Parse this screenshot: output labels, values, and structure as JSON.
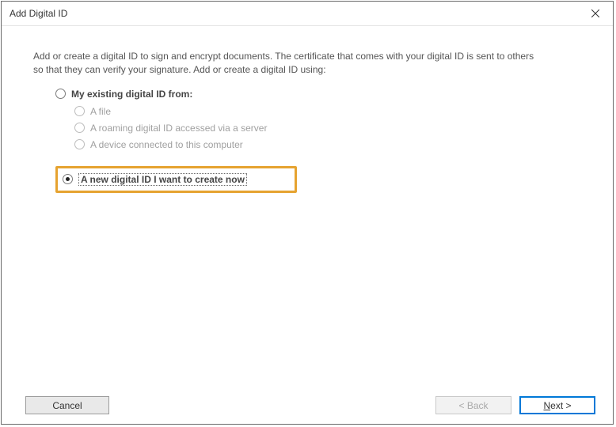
{
  "window": {
    "title": "Add Digital ID"
  },
  "intro": "Add or create a digital ID to sign and encrypt documents. The certificate that comes with your digital ID is sent to others so that they can verify your signature. Add or create a digital ID using:",
  "options": {
    "existing": {
      "label": "My existing digital ID from:",
      "selected": false,
      "sub": {
        "file": "A file",
        "roaming": "A roaming digital ID accessed via a server",
        "device": "A device connected to this computer"
      }
    },
    "new": {
      "label": "A new digital ID I want to create now",
      "selected": true
    }
  },
  "buttons": {
    "cancel": "Cancel",
    "back": "< Back",
    "next_prefix": "N",
    "next_suffix": "ext >"
  }
}
